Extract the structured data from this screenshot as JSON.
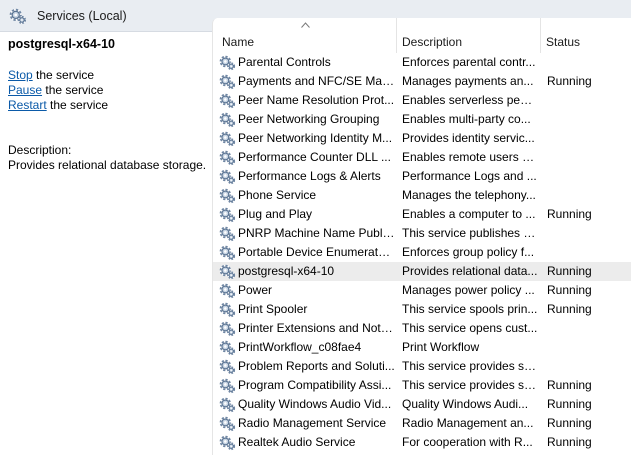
{
  "window": {
    "title": "Services (Local)",
    "icon": "gear-icon"
  },
  "left_pane": {
    "service_name": "postgresql-x64-10",
    "actions": [
      {
        "link": "Stop",
        "rest": " the service"
      },
      {
        "link": "Pause",
        "rest": " the service"
      },
      {
        "link": "Restart",
        "rest": " the service"
      }
    ],
    "description_label": "Description:",
    "description_text": "Provides relational database storage."
  },
  "table": {
    "columns": [
      "Name",
      "Description",
      "Status"
    ],
    "sort_indicator": "^",
    "selected_index": 11,
    "rows": [
      {
        "name": "Parental Controls",
        "description": "Enforces parental contr...",
        "status": ""
      },
      {
        "name": "Payments and NFC/SE Man...",
        "description": "Manages payments an...",
        "status": "Running"
      },
      {
        "name": "Peer Name Resolution Prot...",
        "description": "Enables serverless peer ...",
        "status": ""
      },
      {
        "name": "Peer Networking Grouping",
        "description": "Enables multi-party co...",
        "status": ""
      },
      {
        "name": "Peer Networking Identity M...",
        "description": "Provides identity servic...",
        "status": ""
      },
      {
        "name": "Performance Counter DLL ...",
        "description": "Enables remote users a...",
        "status": ""
      },
      {
        "name": "Performance Logs & Alerts",
        "description": "Performance Logs and ...",
        "status": ""
      },
      {
        "name": "Phone Service",
        "description": "Manages the telephony...",
        "status": ""
      },
      {
        "name": "Plug and Play",
        "description": "Enables a computer to ...",
        "status": "Running"
      },
      {
        "name": "PNRP Machine Name Publi...",
        "description": "This service publishes a...",
        "status": ""
      },
      {
        "name": "Portable Device Enumerator...",
        "description": "Enforces group policy f...",
        "status": ""
      },
      {
        "name": "postgresql-x64-10",
        "description": "Provides relational data...",
        "status": "Running"
      },
      {
        "name": "Power",
        "description": "Manages power policy ...",
        "status": "Running"
      },
      {
        "name": "Print Spooler",
        "description": "This service spools prin...",
        "status": "Running"
      },
      {
        "name": "Printer Extensions and Notif...",
        "description": "This service opens cust...",
        "status": ""
      },
      {
        "name": "PrintWorkflow_c08fae4",
        "description": "Print Workflow",
        "status": ""
      },
      {
        "name": "Problem Reports and Soluti...",
        "description": "This service provides su...",
        "status": ""
      },
      {
        "name": "Program Compatibility Assi...",
        "description": "This service provides su...",
        "status": "Running"
      },
      {
        "name": "Quality Windows Audio Vid...",
        "description": "Quality Windows Audi...",
        "status": "Running"
      },
      {
        "name": "Radio Management Service",
        "description": "Radio Management an...",
        "status": "Running"
      },
      {
        "name": "Realtek Audio Service",
        "description": "For cooperation with R...",
        "status": "Running"
      }
    ]
  }
}
